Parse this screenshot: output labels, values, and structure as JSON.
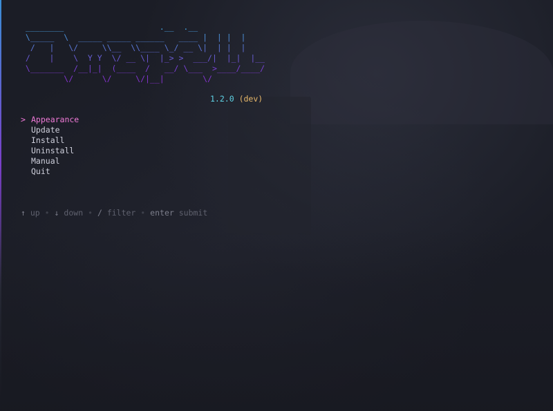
{
  "logo": {
    "ascii": " ________                    .__  .__   \n \\_____  \\  _____ _____ ______   ____ |  | |  |  \n  /   |   \\/     \\\\__  \\\\____ \\_/ __ \\|  | |  |  \n /    |    \\  Y Y  \\/ __ \\|  |_> >  ___/|  |_|  |__\n \\_______  /__|_|  (____  /   __/ \\___  >____/____/\n         \\/      \\/     \\/|__|        \\/           "
  },
  "version": {
    "number": "1.2.0",
    "tag": "(dev)"
  },
  "menu": {
    "cursor": ">",
    "items": [
      {
        "label": "Appearance"
      },
      {
        "label": "Update"
      },
      {
        "label": "Install"
      },
      {
        "label": "Uninstall"
      },
      {
        "label": "Manual"
      },
      {
        "label": "Quit"
      }
    ],
    "selected_index": 0
  },
  "help": {
    "up_key": "↑",
    "up_label": "up",
    "down_key": "↓",
    "down_label": "down",
    "filter_key": "/",
    "filter_label": "filter",
    "enter_key": "enter",
    "enter_label": "submit",
    "separator": "•"
  },
  "colors": {
    "background": "#1b1d26",
    "accent_pink": "#f07ad8",
    "version_cyan": "#5fd4e6",
    "version_tag": "#e8b86a",
    "logo_top": "#3db7e6",
    "logo_bottom": "#8a2fd0"
  }
}
